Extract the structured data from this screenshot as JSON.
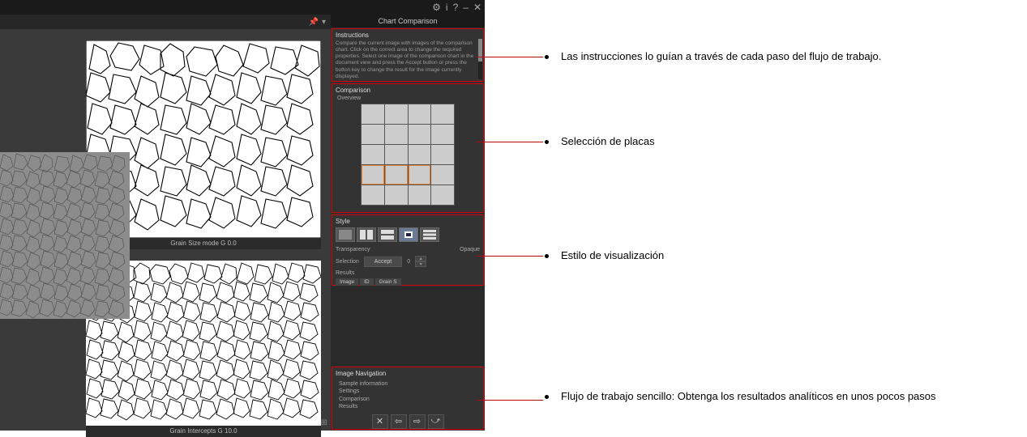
{
  "titlebar": {
    "gear": "⚙",
    "info": "i",
    "help": "?",
    "min": "–",
    "close": "✕"
  },
  "doctab": {
    "pin": "📌",
    "drop": "▾"
  },
  "canvas": {
    "caption_top": "Grain Size mode G 0.0",
    "caption_bot": "Grain Intercepts G 10.0",
    "status": "⊞"
  },
  "panel": {
    "title": "Chart Comparison",
    "instructions": {
      "heading": "Instructions",
      "body": "Compare the current image with images of the comparison chart. Click on the correct area to change the required properties. Select one image of the comparison chart in the document view and press the Accept button or press the button key to change the result for the image currently displayed."
    },
    "comparison": {
      "heading": "Comparison",
      "label": "Overview"
    },
    "style": {
      "heading": "Style",
      "transparency": "Transparency",
      "opaque": "Opaque",
      "opaque_val": "0",
      "selection": "Selection",
      "accept": "Accept",
      "results": "Results",
      "tabs": [
        "Image",
        "ID",
        "Grain S"
      ]
    },
    "workflow": {
      "heading": "Image Navigation",
      "items": [
        "Sample information",
        "Settings",
        "Comparison",
        "Results"
      ]
    }
  },
  "annotations": {
    "a1": "Las instrucciones lo guían a través de cada paso del flujo de trabajo.",
    "a2": "Selección de placas",
    "a3": "Estilo de visualización",
    "a4": "Flujo de trabajo sencillo: Obtenga los resultados analíticos en unos pocos pasos"
  }
}
